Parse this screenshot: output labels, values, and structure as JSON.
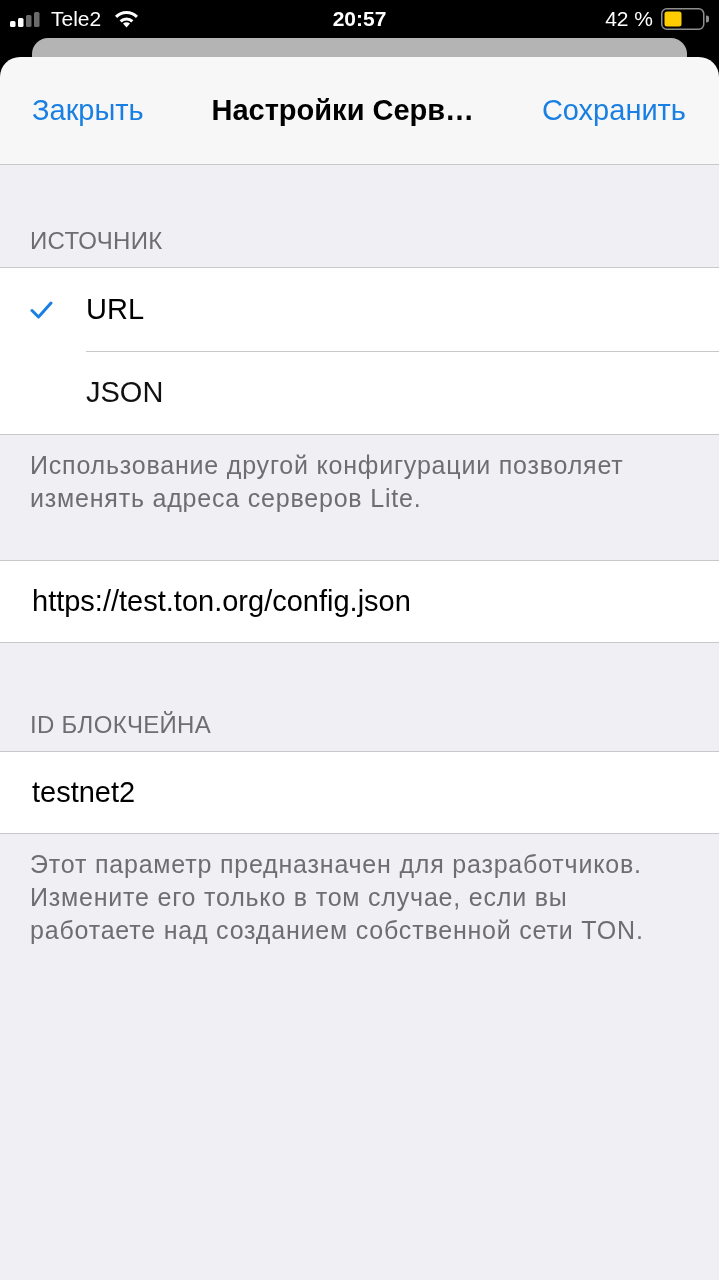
{
  "status_bar": {
    "carrier": "Tele2",
    "time": "20:57",
    "battery": "42 %"
  },
  "nav_bar": {
    "left_button": "Закрыть",
    "title": "Настройки Серв…",
    "right_button": "Сохранить"
  },
  "sections": [
    {
      "kind": "options",
      "header": "ИСТОЧНИК",
      "options": [
        {
          "label": "URL",
          "selected": true
        },
        {
          "label": "JSON",
          "selected": false
        }
      ],
      "footer": "Использование другой конфигурации позволяет изменять адреса серверов Lite."
    },
    {
      "kind": "field",
      "value": "https://test.ton.org/config.json"
    },
    {
      "kind": "field",
      "header": "ID БЛОКЧЕЙНА",
      "value": "testnet2",
      "footer": "Этот параметр предназначен для разработчиков. Измените его только в том случае, если вы работаете над созданием собственной сети TON."
    }
  ]
}
